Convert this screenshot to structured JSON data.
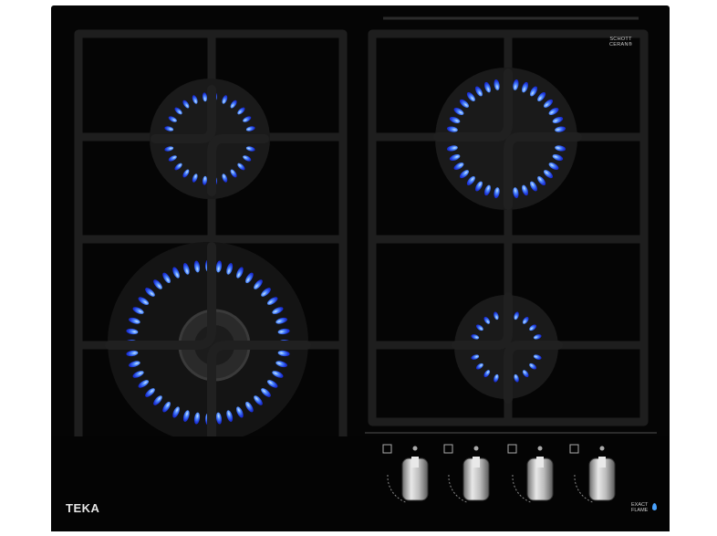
{
  "appliance": {
    "brand": "TEKA",
    "glass_brand_line1": "SCHOTT",
    "glass_brand_line2": "CERAN®",
    "technology_line1": "EXACT",
    "technology_line2": "FLAME"
  },
  "burners": [
    {
      "name": "rear-left",
      "flame_rings": 1
    },
    {
      "name": "front-left",
      "flame_rings": 2
    },
    {
      "name": "rear-right",
      "flame_rings": 1
    },
    {
      "name": "front-right",
      "flame_rings": 1
    }
  ],
  "control_knobs": 4,
  "colors": {
    "glass": "#060606",
    "grate": "#1c1c1c",
    "flame": "#3b6cff",
    "flame_core": "#9fd4ff",
    "knob": "#b8b8b8"
  }
}
